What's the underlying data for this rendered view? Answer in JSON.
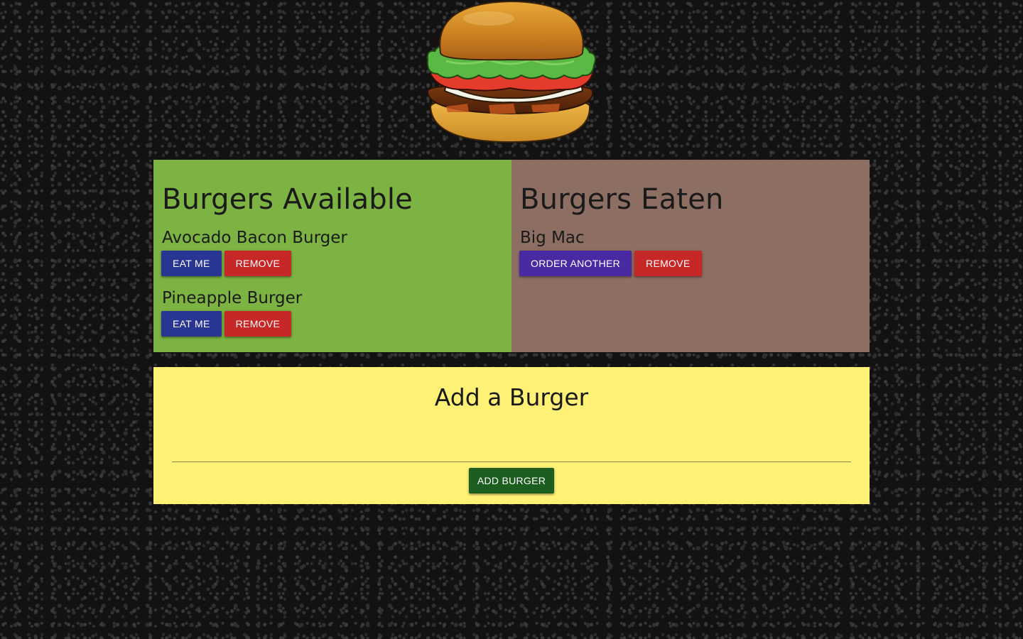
{
  "header": {
    "logo_icon": "hamburger-icon"
  },
  "available": {
    "title": "Burgers Available",
    "items": [
      {
        "name": "Avocado Bacon Burger",
        "eat_label": "EAT ME",
        "remove_label": "REMOVE"
      },
      {
        "name": "Pineapple Burger",
        "eat_label": "EAT ME",
        "remove_label": "REMOVE"
      }
    ],
    "color": "#7cb342"
  },
  "eaten": {
    "title": "Burgers Eaten",
    "items": [
      {
        "name": "Big Mac",
        "order_label": "ORDER ANOTHER",
        "remove_label": "REMOVE"
      }
    ],
    "color": "#8d6e63"
  },
  "add": {
    "title": "Add a Burger",
    "input_value": "",
    "input_placeholder": "",
    "button_label": "ADD BURGER",
    "color": "#fff176"
  },
  "colors": {
    "eat_button": "#283593",
    "remove_button": "#c62828",
    "order_button": "#4a2aa3",
    "add_button": "#1b5e20"
  }
}
